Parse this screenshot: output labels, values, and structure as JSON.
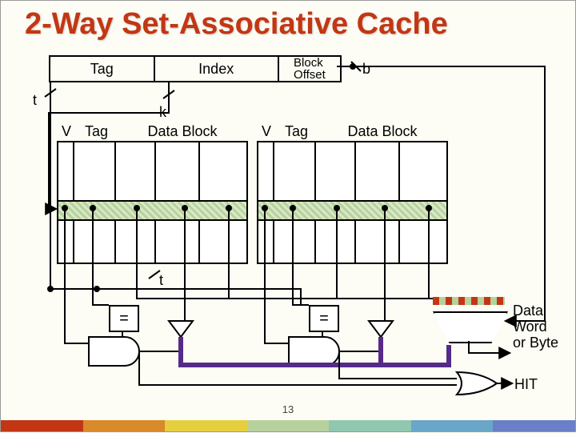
{
  "title": "2-Way Set-Associative Cache",
  "address_fields": {
    "tag": "Tag",
    "index": "Index",
    "block_offset": "Block\nOffset"
  },
  "bitwidth_labels": {
    "t": "t",
    "k": "k",
    "b": "b",
    "t2": "t"
  },
  "array_columns": {
    "v": "V",
    "tag": "Tag",
    "data_block": "Data Block"
  },
  "comparator": "=",
  "output_label": "Data\nWord\nor Byte",
  "hit_label": "HIT",
  "page_number": "13",
  "accent_colors": [
    "#c33614",
    "#d98a2a",
    "#e6cf3f",
    "#b7d19c",
    "#8fc7b0",
    "#6aa6c8",
    "#6a7fc8"
  ]
}
